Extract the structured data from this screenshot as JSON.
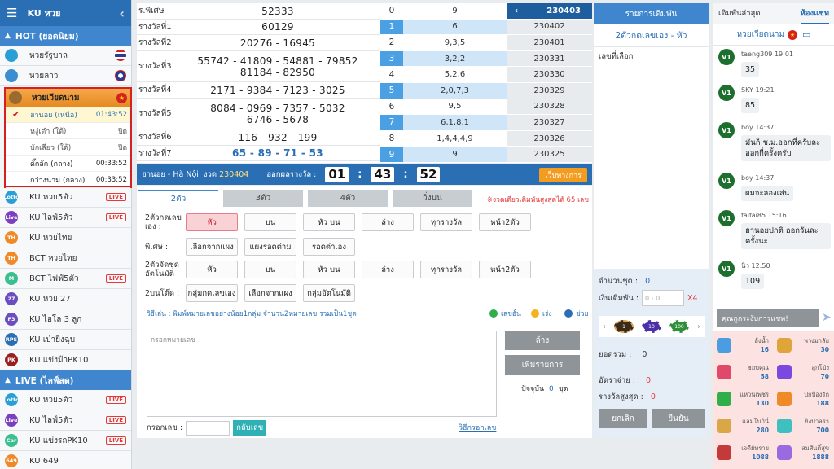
{
  "sidebar": {
    "header": "KU หวย",
    "hot_section": "HOT (ยอดนิยม)",
    "hot_items": [
      {
        "label": "หวยรัฐบาล",
        "icon": "gear-badge-icon",
        "color": "#2a9fd6"
      },
      {
        "label": "หวยลาว",
        "icon": "laos-icon",
        "color": "#3a8fd1"
      }
    ],
    "vietnam": {
      "label": "หวยเวียดนาม",
      "rows": [
        {
          "label": "ฮานอย (เหนือ)",
          "time": "01:43:52"
        },
        {
          "label": "หงู่เต๋า (ใต้)",
          "time": "ปิด"
        },
        {
          "label": "บักเลียว (ใต้)",
          "time": "ปิด"
        },
        {
          "label": "ดั๊กลัก (กลาง)",
          "time": "00:33:52"
        },
        {
          "label": "กว่างนาม (กลาง)",
          "time": "00:33:52"
        }
      ]
    },
    "items": [
      {
        "label": "KU หวย5ตัว",
        "ic": "Lotto",
        "color": "#2a9fd6",
        "live": "LIVE"
      },
      {
        "label": "KU ไลฟ์5ตัว",
        "ic": "Live",
        "color": "#7b3fbf",
        "live": "LIVE"
      },
      {
        "label": "KU หวยไทย",
        "ic": "TH",
        "color": "#f08a28",
        "live": ""
      },
      {
        "label": "BCT หวยไทย",
        "ic": "TH",
        "color": "#f08a28",
        "live": ""
      },
      {
        "label": "BCT ไฟฟ์5ตัว",
        "ic": "M",
        "color": "#3bbf8e",
        "live": "LIVE"
      },
      {
        "label": "KU หวย 27",
        "ic": "27",
        "color": "#6b4fbf",
        "live": ""
      },
      {
        "label": "KU ไฮโล 3 ลูก",
        "ic": "F3",
        "color": "#6b4fbf",
        "live": ""
      },
      {
        "label": "KU เป่ายิงฉุบ",
        "ic": "RPS",
        "color": "#2a6fb4",
        "live": ""
      },
      {
        "label": "KU แข่งม้าPK10",
        "ic": "PK",
        "color": "#9a2020",
        "live": ""
      }
    ],
    "live_section": "LIVE (ไลฟ์สด)",
    "live_items": [
      {
        "label": "KU หวย5ตัว",
        "ic": "Lotto",
        "color": "#2a9fd6",
        "live": "LIVE"
      },
      {
        "label": "KU ไลฟ์5ตัว",
        "ic": "Live",
        "color": "#7b3fbf",
        "live": "LIVE"
      },
      {
        "label": "KU แข่งรถPK10",
        "ic": "Car",
        "color": "#3bbf8e",
        "live": "LIVE"
      },
      {
        "label": "KU 649",
        "ic": "649",
        "color": "#f08a28",
        "live": ""
      }
    ]
  },
  "results": [
    {
      "label": "ร.พิเศษ",
      "lines": [
        "52333"
      ]
    },
    {
      "label": "รางวัลที่1",
      "lines": [
        "60129"
      ]
    },
    {
      "label": "รางวัลที่2",
      "lines": [
        "20276 - 16945"
      ]
    },
    {
      "label": "รางวัลที่3",
      "lines": [
        "55742 - 41809 - 54881 - 79852",
        "81184 - 82950"
      ]
    },
    {
      "label": "รางวัลที่4",
      "lines": [
        "2171 - 9384 - 7123 - 3025"
      ]
    },
    {
      "label": "รางวัลที่5",
      "lines": [
        "8084 - 0969 - 7357 - 5032",
        "6746 - 5678"
      ]
    },
    {
      "label": "รางวัลที่6",
      "lines": [
        "116 - 932 - 199"
      ]
    },
    {
      "label": "รางวัลที่7",
      "lines": [
        "65 - 89 - 71 - 53"
      ]
    }
  ],
  "digits": [
    {
      "d": "0",
      "v": "9",
      "c": "230403"
    },
    {
      "d": "1",
      "v": "6",
      "c": "230402"
    },
    {
      "d": "2",
      "v": "9,3,5",
      "c": "230401"
    },
    {
      "d": "3",
      "v": "3,2,2",
      "c": "230331"
    },
    {
      "d": "4",
      "v": "5,2,6",
      "c": "230330"
    },
    {
      "d": "5",
      "v": "2,0,7,3",
      "c": "230329"
    },
    {
      "d": "6",
      "v": "9,5",
      "c": "230328"
    },
    {
      "d": "7",
      "v": "6,1,8,1",
      "c": "230327"
    },
    {
      "d": "8",
      "v": "1,4,4,4,9",
      "c": "230326"
    },
    {
      "d": "9",
      "v": "9",
      "c": "230325"
    }
  ],
  "status": {
    "name": "ฮานอย - Hà Nội",
    "round_label": "งวด",
    "round": "230404",
    "draw_label": "ออกผลรางวัล :",
    "hh": "01",
    "mm": "43",
    "ss": "52",
    "rules_button": "เว็บทางการ"
  },
  "bet": {
    "tabs": [
      "2ตัว",
      "3ตัว",
      "4ตัว",
      "วิ่งบน"
    ],
    "warning": "※งวดเดียวเดิมพันสูงสุดได้ 65 เลข",
    "row1_label": "2ตัวกดเลขเอง :",
    "row1": [
      "หัว",
      "บน",
      "หัว บน",
      "ล่าง",
      "ทุกรางวัล",
      "หน้า2ตัว"
    ],
    "row2_label": "พิเศษ :",
    "row2": [
      "เลือกจากแผง",
      "แผงรอดต่าม",
      "รอดต่าเอง"
    ],
    "row3_label": "2ตัวจัดชุดอัตโนมัติ :",
    "row3": [
      "หัว",
      "บน",
      "หัว บน",
      "ล่าง",
      "ทุกรางวัล",
      "หน้า2ตัว"
    ],
    "row4_label": "2บนโต๊ด :",
    "row4": [
      "กลุ่มกดเลขเอง",
      "เลือกจากแผง",
      "กลุ่มอัตโนมัติ"
    ],
    "hint": "วิธีเล่น : พิมพ์หมายเลขอย่างน้อย1กลุ่ม จำนวน2หมายเลข รวมเป็น1ชุด",
    "legend": [
      "เลขอั้น",
      "เร่ง",
      "ช่วย"
    ],
    "textarea_placeholder": "กรอกหมายเลข",
    "clear_button": "ล้าง",
    "add_button": "เพิ่มรายการ",
    "count_label": "ปัจจุบัน",
    "count": "0",
    "count_unit": "ชุด",
    "input_label": "กรอกเลข :",
    "reverse_button": "กลับเลข",
    "howto_link": "วิธีกรอกเลข"
  },
  "betcol": {
    "head": "รายการเดิมพัน",
    "sub": "2ตัวกดเลขเอง - หัว",
    "selected_label": "เลขที่เลือก",
    "qty_label": "จำนวนชุด :",
    "qty": "0",
    "amount_label": "เงินเดิมพัน :",
    "amount_placeholder": "0 - 0",
    "multiplier": "X4",
    "chips": [
      "1",
      "10",
      "100"
    ],
    "total_label": "ยอดรวม :",
    "total": "0",
    "rate_label": "อัตราจ่าย :",
    "rate": "0",
    "max_label": "รางวัลสูงสุด :",
    "max": "0",
    "cancel": "ยกเลิก",
    "confirm": "ยืนยัน"
  },
  "chat": {
    "tab1": "เดิมพันล่าสุด",
    "tab2": "ห้องแชท",
    "room": "หวยเวียดนาม",
    "messages": [
      {
        "user": "taeng309",
        "time": "19:01",
        "text": "35"
      },
      {
        "user": "SKY",
        "time": "19:21",
        "text": "85"
      },
      {
        "user": "boy",
        "time": "14:37",
        "text": "มันก็ ช.ม.ออกที่ครับละ ออกกี่ครั้งครับ"
      },
      {
        "user": "boy",
        "time": "14:37",
        "text": "ผมจะลองเล่น"
      },
      {
        "user": "faifai85",
        "time": "15:16",
        "text": "ฮานอยปกติ ออกวันละครั้งนะ"
      },
      {
        "user": "นิว",
        "time": "12:50",
        "text": "109"
      }
    ],
    "avatar_label": "V1",
    "input_placeholder": "คุณถูกระงับการแชท!",
    "grid": [
      {
        "label": "ฮ้งน้ำ",
        "value": "16"
      },
      {
        "label": "พวงมาลัย",
        "value": "30"
      },
      {
        "label": "ชอบคุณ",
        "value": "58"
      },
      {
        "label": "ลูกโป่ง",
        "value": "70"
      },
      {
        "label": "แหวนเพชร",
        "value": "130"
      },
      {
        "label": "ปกป้องรัก",
        "value": "188"
      },
      {
        "label": "แลมโบกินี่",
        "value": "280"
      },
      {
        "label": "ยิงปาลรา",
        "value": "700"
      },
      {
        "label": "เจดีย์ทราย",
        "value": "1088"
      },
      {
        "label": "สมสันติ์สุข",
        "value": "1888"
      }
    ]
  },
  "colors": {
    "primary": "#2a6fb4",
    "accent": "#3f86cf",
    "orange": "#f39c1f",
    "red": "#d42020"
  }
}
